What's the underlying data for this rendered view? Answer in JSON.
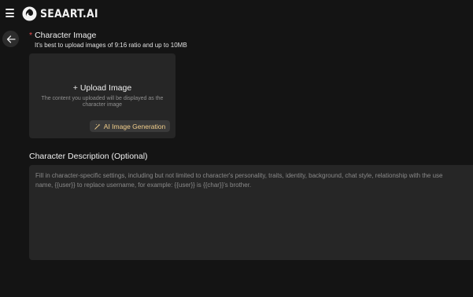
{
  "header": {
    "brand": "SEAART.AI",
    "icons": {
      "menu": "hamburger-menu-icon",
      "logo": "seaart-logo-icon"
    }
  },
  "nav": {
    "back_icon": "arrow-left-icon"
  },
  "character_image": {
    "required_mark": "*",
    "label": "Character Image",
    "hint": "It's best to upload images of 9:16 ratio and up to 10MB",
    "upload": {
      "title": "+ Upload Image",
      "description": "The content you uploaded will be displayed as the character image"
    },
    "ai_button": {
      "label": "AI Image Generation",
      "icon": "magic-wand-icon"
    }
  },
  "character_description": {
    "label": "Character Description (Optional)",
    "placeholder_line1": "Fill in character-specific settings, including but not limited to character's personality, traits, identity, background, chat style, relationship with the use",
    "placeholder_line2": "name, {{user}} to replace username, for example: {{user}} is {{char}}'s brother."
  },
  "colors": {
    "background": "#141414",
    "panel": "#262626",
    "accent_gold": "#f3cf8c",
    "required_red": "#e5484d"
  }
}
